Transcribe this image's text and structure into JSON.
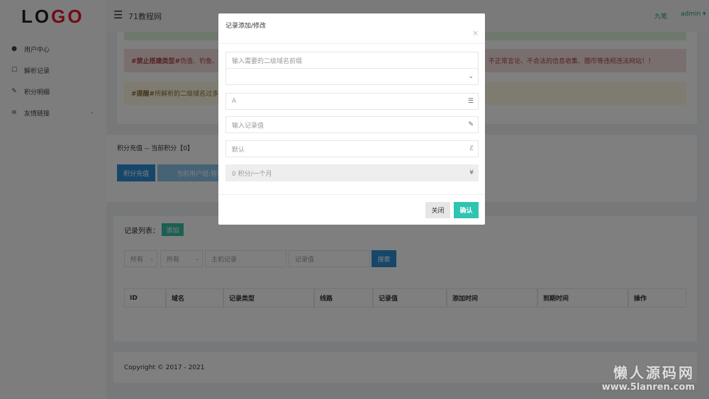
{
  "logo": {
    "a": "LO",
    "b": "GO"
  },
  "site_title": "71教程网",
  "user": {
    "name": "九笔",
    "account": "admin"
  },
  "sidebar": {
    "items": [
      {
        "label": "用户中心",
        "icon": "user-icon"
      },
      {
        "label": "解析记录",
        "icon": "record-icon"
      },
      {
        "label": "积分明细",
        "icon": "pencil-icon"
      },
      {
        "label": "友情链接",
        "icon": "menu-icon"
      }
    ]
  },
  "alerts": {
    "red_tag": "#禁止搭建类型#",
    "red_a": " 伪造、钓鱼、诈",
    "red_b": "、不正常言论、不合法的信息收集、圈币等违规违法网站！！",
    "yellow_tag": "#提醒#",
    "yellow_text": " 所解析的二级域名过多不"
  },
  "points": {
    "title": "积分充值 -- 当前积分【0】",
    "recharge": "积分充值",
    "group": "当前用户组:管理"
  },
  "records": {
    "title": "记录列表：",
    "add": "添加",
    "filter1": "所有",
    "filter2": "所有",
    "host_ph": "主机记录",
    "value_ph": "记录值",
    "search": "搜索",
    "columns": [
      "ID",
      "域名",
      "记录类型",
      "线路",
      "记录值",
      "添加时间",
      "到期时间",
      "操作"
    ]
  },
  "footer": "Copyright © 2017 - 2021",
  "watermark": {
    "a": "懒人源码网",
    "b": "www.5lanren.com"
  },
  "modal": {
    "title": "记录添加/修改",
    "close_x": "×",
    "prefix_ph": "输入需要的二级域名前缀",
    "type_value": "A",
    "value_ph": "输入记录值",
    "line_ph": "默认",
    "cost": "0 积分/一个月",
    "yen": "¥",
    "close": "关闭",
    "confirm": "确认"
  }
}
